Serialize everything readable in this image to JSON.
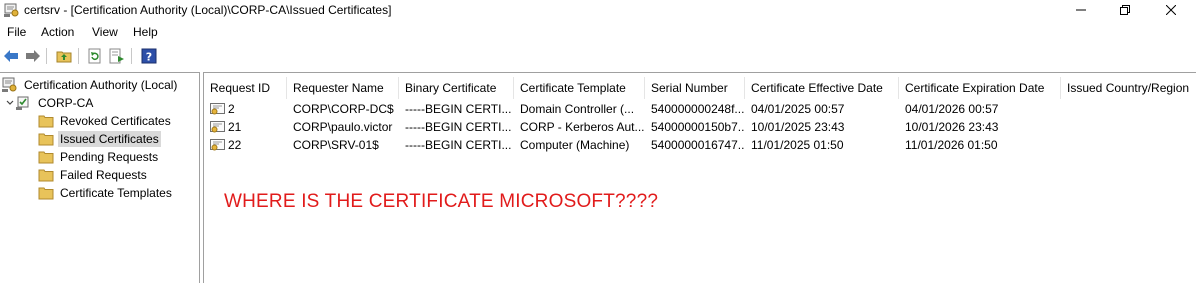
{
  "window": {
    "title": "certsrv - [Certification Authority (Local)\\CORP-CA\\Issued Certificates]"
  },
  "menu": [
    "File",
    "Action",
    "View",
    "Help"
  ],
  "icons": {
    "app": "certsrv-app-icon",
    "back": "back-arrow-icon",
    "forward": "forward-arrow-icon",
    "up": "up-folder-icon",
    "refresh": "refresh-icon",
    "export": "export-list-icon",
    "help": "help-icon",
    "cert": "certificate-icon",
    "folder": "folder-icon",
    "ca": "certification-authority-icon"
  },
  "colors": {
    "annotation": "#e11b1b",
    "selection": "#d9d9d9",
    "folder": "#e8c35a"
  },
  "tree": {
    "root": "Certification Authority (Local)",
    "ca": "CORP-CA",
    "items": [
      {
        "label": "Revoked Certificates",
        "selected": false
      },
      {
        "label": "Issued Certificates",
        "selected": true
      },
      {
        "label": "Pending Requests",
        "selected": false
      },
      {
        "label": "Failed Requests",
        "selected": false
      },
      {
        "label": "Certificate Templates",
        "selected": false
      }
    ]
  },
  "list": {
    "columns": [
      "Request ID",
      "Requester Name",
      "Binary Certificate",
      "Certificate Template",
      "Serial Number",
      "Certificate Effective Date",
      "Certificate Expiration Date",
      "Issued Country/Region"
    ],
    "rows": [
      [
        "2",
        "CORP\\CORP-DC$",
        "-----BEGIN CERTI...",
        "Domain Controller (...",
        "540000000248f...",
        "04/01/2025 00:57",
        "04/01/2026 00:57",
        ""
      ],
      [
        "21",
        "CORP\\paulo.victor",
        "-----BEGIN CERTI...",
        "CORP - Kerberos Aut...",
        "54000000150b7...",
        "10/01/2025 23:43",
        "10/01/2026 23:43",
        ""
      ],
      [
        "22",
        "CORP\\SRV-01$",
        "-----BEGIN CERTI...",
        "Computer (Machine)",
        "5400000016747...",
        "11/01/2025 01:50",
        "11/01/2026 01:50",
        ""
      ]
    ]
  },
  "annotation": "WHERE IS THE CERTIFICATE MICROSOFT????"
}
